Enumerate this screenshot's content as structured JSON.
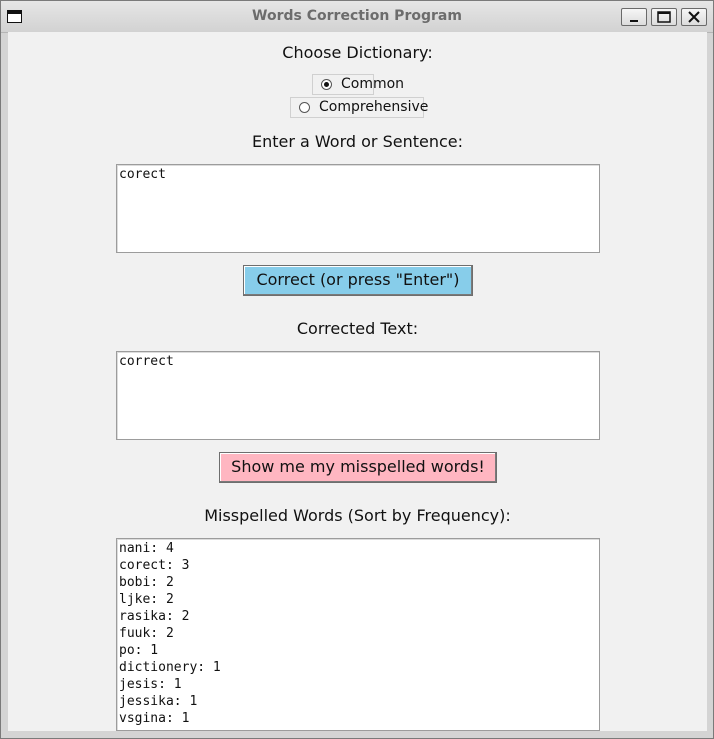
{
  "window": {
    "title": "Words Correction Program"
  },
  "dictionary": {
    "label": "Choose Dictionary:",
    "options": [
      {
        "label": "Common",
        "selected": true
      },
      {
        "label": "Comprehensive",
        "selected": false
      }
    ]
  },
  "input": {
    "label": "Enter a Word or Sentence:",
    "value": "corect"
  },
  "correct_button": {
    "label": "Correct (or press \"Enter\")",
    "color": "#87cdea"
  },
  "output": {
    "label": "Corrected Text:",
    "value": "correct"
  },
  "show_button": {
    "label": "Show me my misspelled words!",
    "color": "#ffb6c1"
  },
  "misspelled": {
    "label": "Misspelled Words (Sort by Frequency):",
    "items": [
      "nani: 4",
      "corect: 3",
      "bobi: 2",
      "ljke: 2",
      "rasika: 2",
      "fuuk: 2",
      "po: 1",
      "dictionery: 1",
      "jesis: 1",
      "jessika: 1",
      "vsgina: 1"
    ]
  },
  "icons": {
    "app": "window-icon",
    "minimize": "minimize-icon",
    "maximize": "maximize-icon",
    "close": "close-icon"
  }
}
